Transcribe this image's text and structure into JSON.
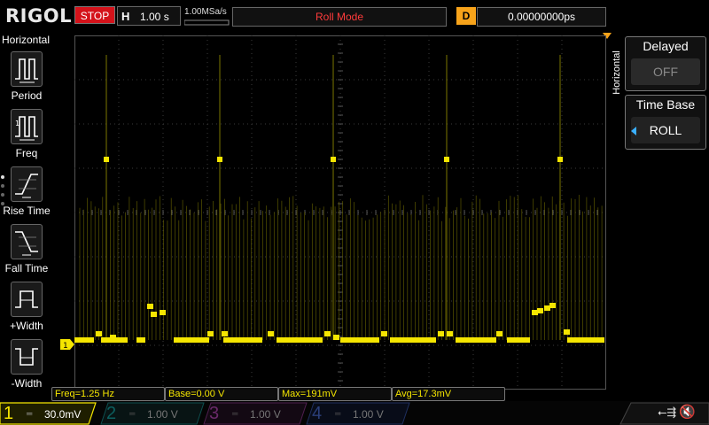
{
  "header": {
    "brand": "RIGOL",
    "run_state": "STOP",
    "timebase_label": "H",
    "timebase_value": "1.00 s",
    "sample_rate": "1.00MSa/s",
    "mode": "Roll Mode",
    "delay_label": "D",
    "delay_value": "0.00000000ps"
  },
  "left_menu": {
    "title": "Horizontal",
    "items": [
      {
        "label": "Period",
        "icon": "period-icon"
      },
      {
        "label": "Freq",
        "icon": "freq-icon"
      },
      {
        "label": "Rise Time",
        "icon": "rise-time-icon"
      },
      {
        "label": "Fall Time",
        "icon": "fall-time-icon"
      },
      {
        "label": "+Width",
        "icon": "pos-width-icon"
      },
      {
        "label": "-Width",
        "icon": "neg-width-icon"
      }
    ]
  },
  "right_menu": {
    "side_label": "Horizontal",
    "delayed": {
      "title": "Delayed",
      "value": "OFF"
    },
    "time_base": {
      "title": "Time Base",
      "value": "ROLL"
    }
  },
  "measurements": {
    "freq": "Freq=1.25 Hz",
    "base": "Base=0.00 V",
    "max": "Max=191mV",
    "avg": "Avg=17.3mV"
  },
  "channels": [
    {
      "num": "1",
      "scale": "30.0mV",
      "color": "#ffe600",
      "active": true
    },
    {
      "num": "2",
      "scale": "1.00 V",
      "color": "#00d0d0",
      "active": false
    },
    {
      "num": "3",
      "scale": "1.00 V",
      "color": "#d040d0",
      "active": false
    },
    {
      "num": "4",
      "scale": "1.00 V",
      "color": "#3a7fff",
      "active": false
    }
  ],
  "ch1_marker": "1",
  "colors": {
    "trace": "#f5e600",
    "grid": "#3a3a3a",
    "run_state_bg": "#d4121a",
    "trigger_orange": "#f7a31a"
  },
  "status_icons": [
    "usb-icon",
    "speaker-muted-icon"
  ]
}
